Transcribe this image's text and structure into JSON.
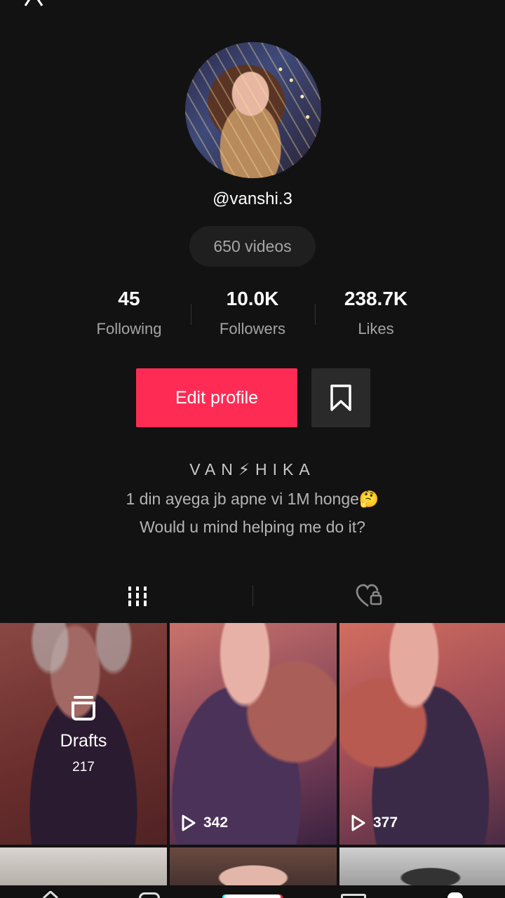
{
  "profile": {
    "username": "@vanshi.3",
    "videos_count": "650 videos"
  },
  "stats": [
    {
      "value": "45",
      "label": "Following"
    },
    {
      "value": "10.0K",
      "label": "Followers"
    },
    {
      "value": "238.7K",
      "label": "Likes"
    }
  ],
  "actions": {
    "edit_profile": "Edit profile"
  },
  "bio": {
    "name": "VAN⚡HIKA",
    "line1": "1 din ayega jb apne vi 1M honge🤔",
    "line2": "Would u mind helping me do it?"
  },
  "tabs": {
    "videos_icon": "grid-bars-icon",
    "liked_icon": "heart-lock-icon"
  },
  "grid": {
    "drafts_label": "Drafts",
    "drafts_count": "217",
    "items": [
      {
        "views": "342"
      },
      {
        "views": "377"
      }
    ]
  },
  "nav": [
    "home-icon",
    "discover-icon",
    "create-icon",
    "inbox-icon",
    "me-icon"
  ],
  "colors": {
    "background": "#121212",
    "accent": "#fe2c55"
  }
}
